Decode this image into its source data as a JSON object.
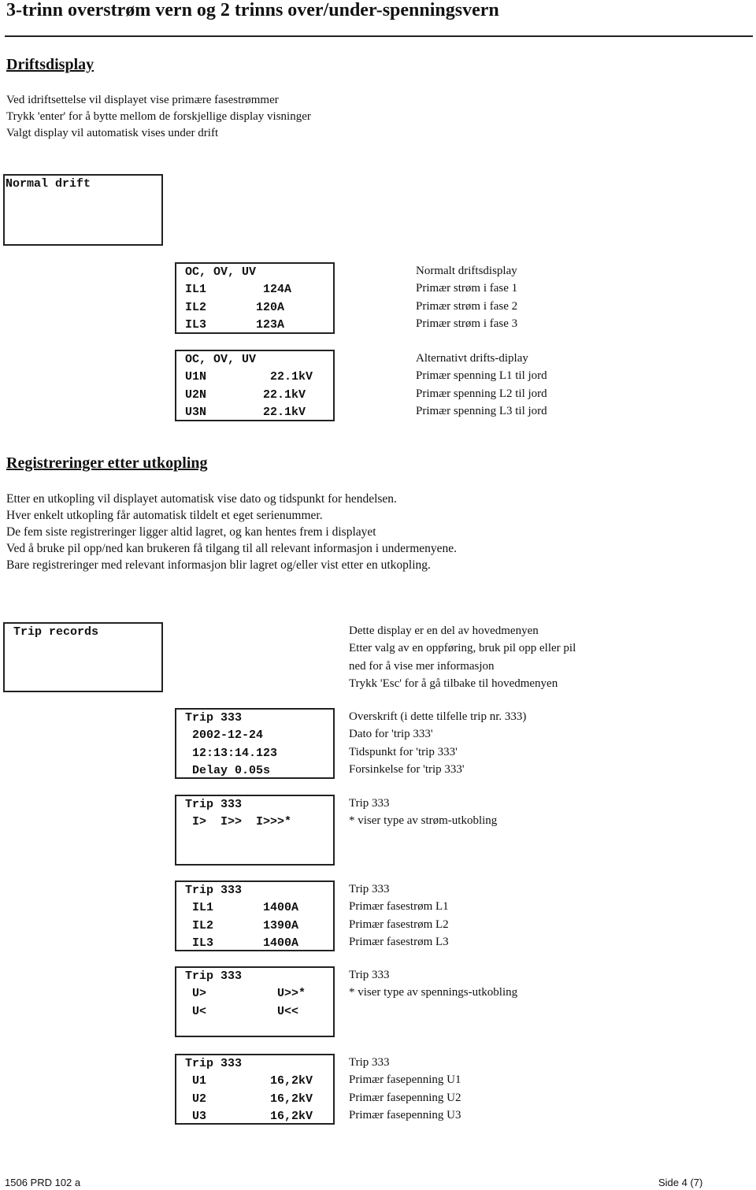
{
  "title": "3-trinn overstrøm vern og 2 trinns over/under-spenningsvern",
  "section1": {
    "heading": "Driftsdisplay",
    "paragraph": [
      "Ved idriftsettelse vil displayet vise primære fasestrømmer",
      "Trykk 'enter' for å bytte mellom de forskjellige display visninger",
      "Valgt display vil automatisk vises under drift"
    ],
    "normal_box": "Normal drift",
    "display1": {
      "lines": [
        "OC, OV, UV",
        "IL1        124A",
        "IL2       120A",
        "IL3       123A"
      ],
      "desc": [
        "Normalt driftsdisplay",
        "Primær strøm i fase 1",
        "Primær strøm i fase 2",
        "Primær strøm i fase 3"
      ]
    },
    "display2": {
      "lines": [
        "OC, OV, UV",
        "U1N         22.1kV",
        "U2N        22.1kV",
        "U3N        22.1kV"
      ],
      "desc": [
        "Alternativt drifts-diplay",
        "Primær spenning L1 til jord",
        "Primær spenning L2 til jord",
        "Primær spenning L3 til jord"
      ]
    }
  },
  "section2": {
    "heading": "Registreringer etter utkopling",
    "paragraph": [
      "Etter en utkopling vil displayet automatisk vise dato og tidspunkt for hendelsen.",
      "Hver enkelt utkopling får automatisk tildelt et eget serienummer.",
      "De fem siste registreringer ligger altid lagret, og kan hentes frem i displayet",
      "Ved å bruke pil opp/ned kan brukeren få tilgang til all relevant informasjon i undermenyene.",
      "Bare registreringer med relevant informasjon blir lagret og/eller vist etter en utkopling."
    ],
    "trip_box": {
      "label": " Trip records",
      "desc": [
        "Dette display er en del av hovedmenyen",
        "Etter valg av en oppføring, bruk pil opp eller pil",
        "ned for å vise mer informasjon",
        "Trykk 'Esc' for å gå tilbake til hovedmenyen"
      ]
    },
    "displays": [
      {
        "lines": [
          "Trip 333",
          " 2002-12-24",
          " 12:13:14.123",
          " Delay 0.05s"
        ],
        "desc": [
          "Overskrift (i dette tilfelle trip nr. 333)",
          "Dato for 'trip 333'",
          "Tidspunkt for 'trip 333'",
          "Forsinkelse for 'trip 333'"
        ]
      },
      {
        "lines": [
          "Trip 333",
          " I>  I>>  I>>>*"
        ],
        "desc": [
          "Trip 333",
          " * viser type av strøm-utkobling"
        ]
      },
      {
        "lines": [
          "Trip 333",
          " IL1       1400A",
          " IL2       1390A",
          " IL3       1400A"
        ],
        "desc": [
          "Trip 333",
          "Primær fasestrøm L1",
          "Primær fasestrøm L2",
          "Primær fasestrøm L3"
        ]
      },
      {
        "lines": [
          "Trip 333",
          " U>          U>>*",
          " U<          U<<"
        ],
        "desc": [
          "Trip 333",
          "* viser type av spennings-utkobling"
        ]
      },
      {
        "lines": [
          "Trip 333",
          " U1         16,2kV",
          " U2         16,2kV",
          " U3         16,2kV"
        ],
        "desc": [
          "Trip 333",
          "Primær fasepenning U1",
          "Primær fasepenning U2",
          "Primær fasepenning U3"
        ]
      }
    ]
  },
  "footer": {
    "doc_id": "1506 PRD 102 a",
    "page": "Side  4 (7)"
  }
}
